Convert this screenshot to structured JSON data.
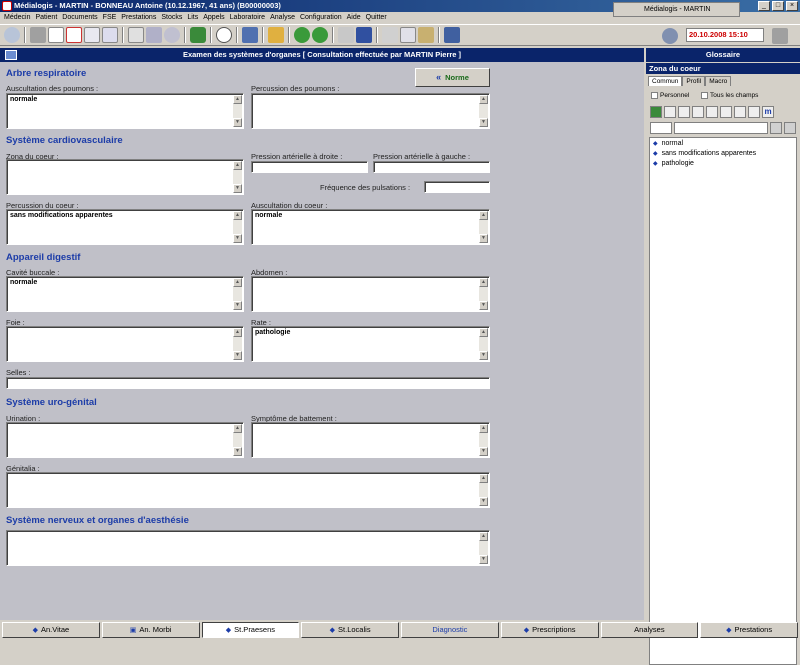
{
  "window": {
    "title": "Médialogis - MARTIN - BONNEAU Antoine   (10.12.1967, 41 ans) (B00000003)",
    "taskbar_label": "Médialogis - MARTIN",
    "datetime": "20.10.2008 15:10"
  },
  "menu": [
    "Médecin",
    "Patient",
    "Documents",
    "FSE",
    "Prestations",
    "Stocks",
    "Lits",
    "Appels",
    "Laboratoire",
    "Analyse",
    "Configuration",
    "Aide",
    "Quitter"
  ],
  "panel": {
    "title": "Examen des systèmes d'organes  [ Consultation effectuée par MARTIN Pierre ]",
    "norme_button": "Norme"
  },
  "sections": {
    "respiratoire": "Arbre respiratoire",
    "cardio": "Système cardiovasculaire",
    "digestif": "Appareil digestif",
    "uro": "Système uro-génital",
    "nerveux": "Système nerveux et organes d'aesthésie"
  },
  "fields": {
    "auscultation_poumons": {
      "label": "Auscultation des poumons :",
      "value": "normale"
    },
    "percussion_poumons": {
      "label": "Percussion des poumons :",
      "value": ""
    },
    "zona_coeur": {
      "label": "Zona du coeur :",
      "value": ""
    },
    "pression_droite": {
      "label": "Pression artérielle à droite :",
      "value": ""
    },
    "pression_gauche": {
      "label": "Pression artérielle à gauche :",
      "value": ""
    },
    "frequence": {
      "label": "Fréquence des pulsations :",
      "value": ""
    },
    "percussion_coeur": {
      "label": "Percussion du coeur :",
      "value": "sans modifications apparentes"
    },
    "auscultation_coeur": {
      "label": "Auscultation du coeur :",
      "value": "normale"
    },
    "cavite_buccale": {
      "label": "Cavité buccale :",
      "value": "normale"
    },
    "abdomen": {
      "label": "Abdomen :",
      "value": ""
    },
    "foie": {
      "label": "Foie :",
      "value": ""
    },
    "rate": {
      "label": "Rate :",
      "value": "pathologie"
    },
    "selles": {
      "label": "Selles :",
      "value": ""
    },
    "urination": {
      "label": "Urination :",
      "value": ""
    },
    "symptome": {
      "label": "Symptôme de battement :",
      "value": ""
    },
    "genitalia": {
      "label": "Génitalia :",
      "value": ""
    },
    "nerveux": {
      "value": ""
    }
  },
  "glossary": {
    "title": "Glossaire",
    "subtitle": "Zona du coeur",
    "tabs": [
      "Commun",
      "Profil",
      "Macro"
    ],
    "checkboxes": [
      "Personnel",
      "Tous les champs"
    ],
    "items": [
      "normal",
      "sans modifications apparentes",
      "pathologie"
    ]
  },
  "bottom_tabs": [
    "An.Vitae",
    "An. Morbi",
    "St.Praesens",
    "St.Localis",
    "Diagnostic",
    "Prescriptions",
    "Analyses",
    "Prestations"
  ],
  "colors": {
    "accent": "#0a246a",
    "section": "#1c3ca8",
    "date": "#cc0000"
  }
}
